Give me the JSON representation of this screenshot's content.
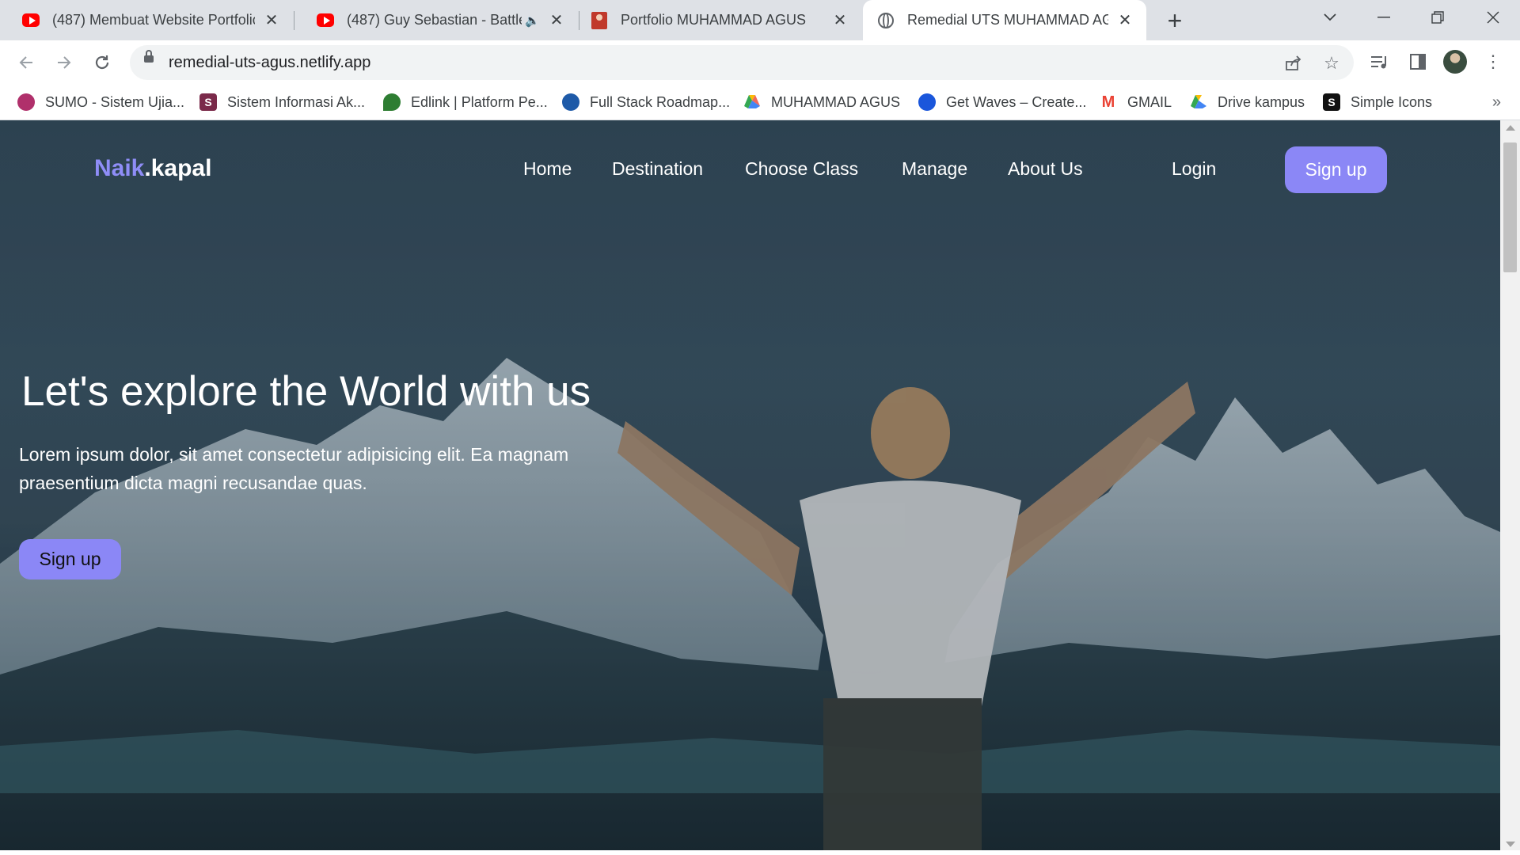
{
  "browser": {
    "tabs": [
      {
        "title": "(487) Membuat Website Portfolio",
        "favicon": "youtube-icon",
        "active": false
      },
      {
        "title": "(487) Guy Sebastian - Battle Sc",
        "favicon": "youtube-icon",
        "active": false,
        "audio": "speaker-icon"
      },
      {
        "title": "Portfolio MUHAMMAD AGUS",
        "favicon": "portfolio-icon",
        "active": false
      },
      {
        "title": "Remedial UTS MUHAMMAD AGUS",
        "favicon": "globe-icon",
        "active": true
      }
    ],
    "address_bar": {
      "url": "remedial-uts-agus.netlify.app"
    },
    "bookmarks": [
      {
        "label": "SUMO - Sistem Ujia...",
        "icon_color": "#b0306b"
      },
      {
        "label": "Sistem Informasi Ak...",
        "icon_color": "#7a2a4a"
      },
      {
        "label": "Edlink | Platform Pe...",
        "icon_color": "#2e7d32"
      },
      {
        "label": "Full Stack Roadmap...",
        "icon_color": "#1e5aa8"
      },
      {
        "label": "MUHAMMAD AGUS",
        "icon_color": "#1e8e3e"
      },
      {
        "label": "Get Waves – Create...",
        "icon_color": "#1a56db"
      },
      {
        "label": "GMAIL",
        "icon_color": "#ea4335"
      },
      {
        "label": "Drive kampus",
        "icon_color": "#1e8e3e"
      },
      {
        "label": "Simple Icons",
        "icon_color": "#111111"
      }
    ]
  },
  "site": {
    "brand": {
      "accent": "Naik",
      "rest": ".kapal"
    },
    "nav": [
      "Home",
      "Destination",
      "Choose Class",
      "Manage",
      "About Us"
    ],
    "login_label": "Login",
    "signup_label": "Sign up",
    "hero": {
      "title": "Let's explore the World with us",
      "text": "Lorem ipsum dolor, sit amet consectetur adipisicing elit. Ea magnam praesentium dicta magni recusandae quas.",
      "button_label": "Sign up"
    }
  },
  "colors": {
    "accent": "#8b87f6",
    "brand_accent": "#8f8df7"
  }
}
